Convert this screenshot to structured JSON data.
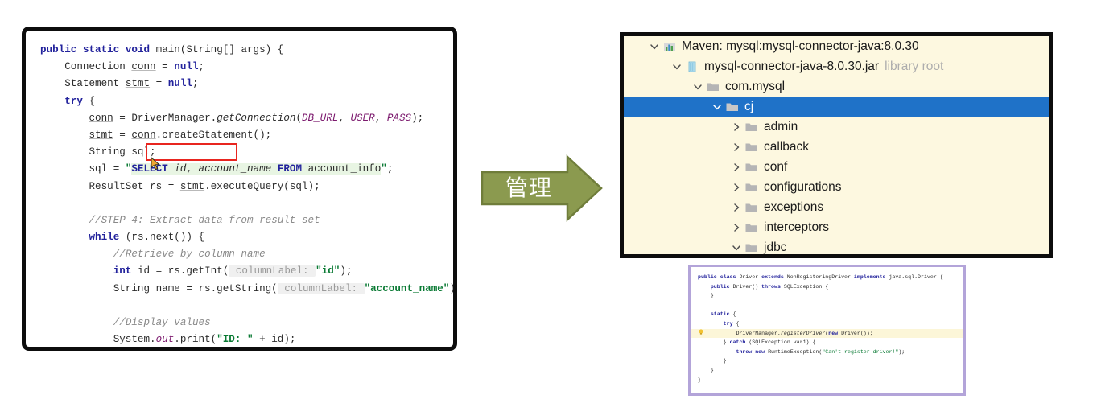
{
  "editor": {
    "panel_name": "java-source-editor",
    "language": "java",
    "highlight_target": "DriverManager",
    "lines": [
      "public static void main(String[] args) {",
      "    Connection conn = null;",
      "    Statement stmt = null;",
      "    try {",
      "        conn = DriverManager.getConnection(DB_URL, USER, PASS);",
      "        stmt = conn.createStatement();",
      "        String sql;",
      "        sql = \"SELECT id, account_name FROM account_info\";",
      "        ResultSet rs = stmt.executeQuery(sql);",
      "",
      "        //STEP 4: Extract data from result set",
      "        while (rs.next()) {",
      "            //Retrieve by column name",
      "            int id = rs.getInt( columnLabel: \"id\");",
      "            String name = rs.getString( columnLabel: \"account_name\");",
      "",
      "            //Display values",
      "            System.out.print(\"ID: \" + id);"
    ]
  },
  "arrow": {
    "label": "管理",
    "fill": "#8b9a4f",
    "stroke": "#6f7d3a",
    "text_color": "#ffffff"
  },
  "tree": {
    "panel_name": "maven-library-tree",
    "background": "#fdf8e0",
    "selection_color": "#1f72c8",
    "items": [
      {
        "label": "Maven: mysql:mysql-connector-java:8.0.30",
        "suffix": "",
        "icon": "maven-icon",
        "indent": 0,
        "chevron": "down",
        "selected": false
      },
      {
        "label": "mysql-connector-java-8.0.30.jar",
        "suffix": "library root",
        "icon": "jar-icon",
        "indent": 1,
        "chevron": "down",
        "selected": false
      },
      {
        "label": "com.mysql",
        "suffix": "",
        "icon": "folder-icon",
        "indent": 2,
        "chevron": "down",
        "selected": false
      },
      {
        "label": "cj",
        "suffix": "",
        "icon": "folder-icon",
        "indent": 3,
        "chevron": "down",
        "selected": true
      },
      {
        "label": "admin",
        "suffix": "",
        "icon": "folder-icon",
        "indent": 4,
        "chevron": "right",
        "selected": false
      },
      {
        "label": "callback",
        "suffix": "",
        "icon": "folder-icon",
        "indent": 4,
        "chevron": "right",
        "selected": false
      },
      {
        "label": "conf",
        "suffix": "",
        "icon": "folder-icon",
        "indent": 4,
        "chevron": "right",
        "selected": false
      },
      {
        "label": "configurations",
        "suffix": "",
        "icon": "folder-icon",
        "indent": 4,
        "chevron": "right",
        "selected": false
      },
      {
        "label": "exceptions",
        "suffix": "",
        "icon": "folder-icon",
        "indent": 4,
        "chevron": "right",
        "selected": false
      },
      {
        "label": "interceptors",
        "suffix": "",
        "icon": "folder-icon",
        "indent": 4,
        "chevron": "right",
        "selected": false
      },
      {
        "label": "jdbc",
        "suffix": "",
        "icon": "folder-icon",
        "indent": 4,
        "chevron": "down",
        "selected": false
      }
    ]
  },
  "snippet": {
    "panel_name": "driver-class-source",
    "border_color": "#b3a4d9",
    "highlighted_line_index": 6,
    "lines": [
      "public class Driver extends NonRegisteringDriver implements java.sql.Driver {",
      "    public Driver() throws SQLException {",
      "    }",
      "",
      "    static {",
      "        try {",
      "            DriverManager.registerDriver(new Driver());",
      "        } catch (SQLException var1) {",
      "            throw new RuntimeException(\"Can't register driver!\");",
      "        }",
      "    }",
      "}"
    ]
  }
}
